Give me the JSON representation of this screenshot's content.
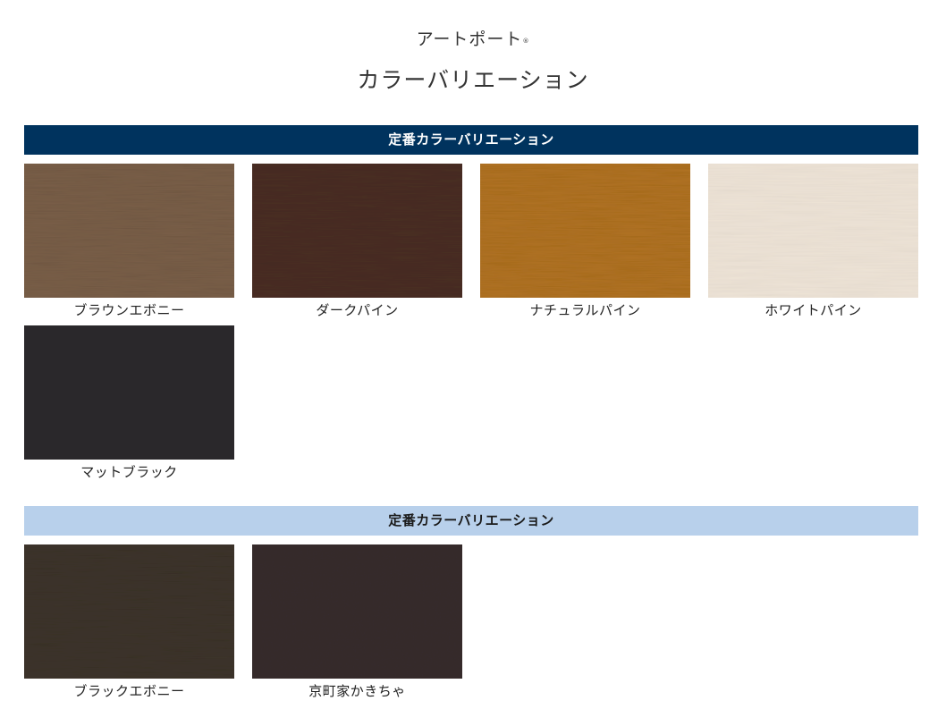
{
  "header": {
    "product_name": "アートポート",
    "registered_mark": "®",
    "title": "カラーバリエーション"
  },
  "sections": [
    {
      "title": "定番カラーバリエーション",
      "color": "#00335e",
      "items": [
        {
          "label": "ブラウンエボニー",
          "color": "#7a5f48"
        },
        {
          "label": "ダークパイン",
          "color": "#4a2e24"
        },
        {
          "label": "ナチュラルパイン",
          "color": "#b27321"
        },
        {
          "label": "ホワイトパイン",
          "color": "#ede3d6"
        },
        {
          "label": "マットブラック",
          "color": "#2a282b"
        }
      ]
    },
    {
      "title": "定番カラーバリエーション",
      "color": "#b8d0eb",
      "items": [
        {
          "label": "ブラックエボニー",
          "color": "#3d342b"
        },
        {
          "label": "京町家かきちゃ",
          "color": "#362c2d"
        }
      ]
    }
  ]
}
